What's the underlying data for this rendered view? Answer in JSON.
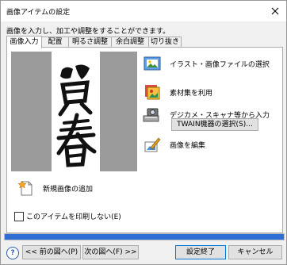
{
  "window": {
    "title": "画像アイテムの設定"
  },
  "intro_text": "画像を入力し、加工や調整をすることができます。",
  "tabs": [
    {
      "label": "画像入力",
      "active": true
    },
    {
      "label": "配置",
      "active": false
    },
    {
      "label": "明るさ調整",
      "active": false
    },
    {
      "label": "余白調整",
      "active": false
    },
    {
      "label": "切り抜き",
      "active": false
    }
  ],
  "preview": {
    "calligraphy_text": "賀春"
  },
  "actions": {
    "select_file": "イラスト・画像ファイルの選択",
    "use_materials": "素材集を利用",
    "input_device": "デジカメ・スキャナ等から入力",
    "twain_button": "TWAIN機器の選択(S)...",
    "edit_image": "画像を編集"
  },
  "new_image_label": "新規画像の追加",
  "no_print_checkbox": {
    "label": "このアイテムを印刷しない(E)",
    "checked": false
  },
  "progress": {
    "value": 1.0
  },
  "footer": {
    "help_label": "?",
    "prev_label": "<< 前の図へ(P)",
    "next_label": "次の図へ(F) >>",
    "finish_label": "設定終了",
    "cancel_label": "キャンセル"
  },
  "colors": {
    "accent": "#2f6fd3",
    "window_bg": "#f0f0f0"
  }
}
